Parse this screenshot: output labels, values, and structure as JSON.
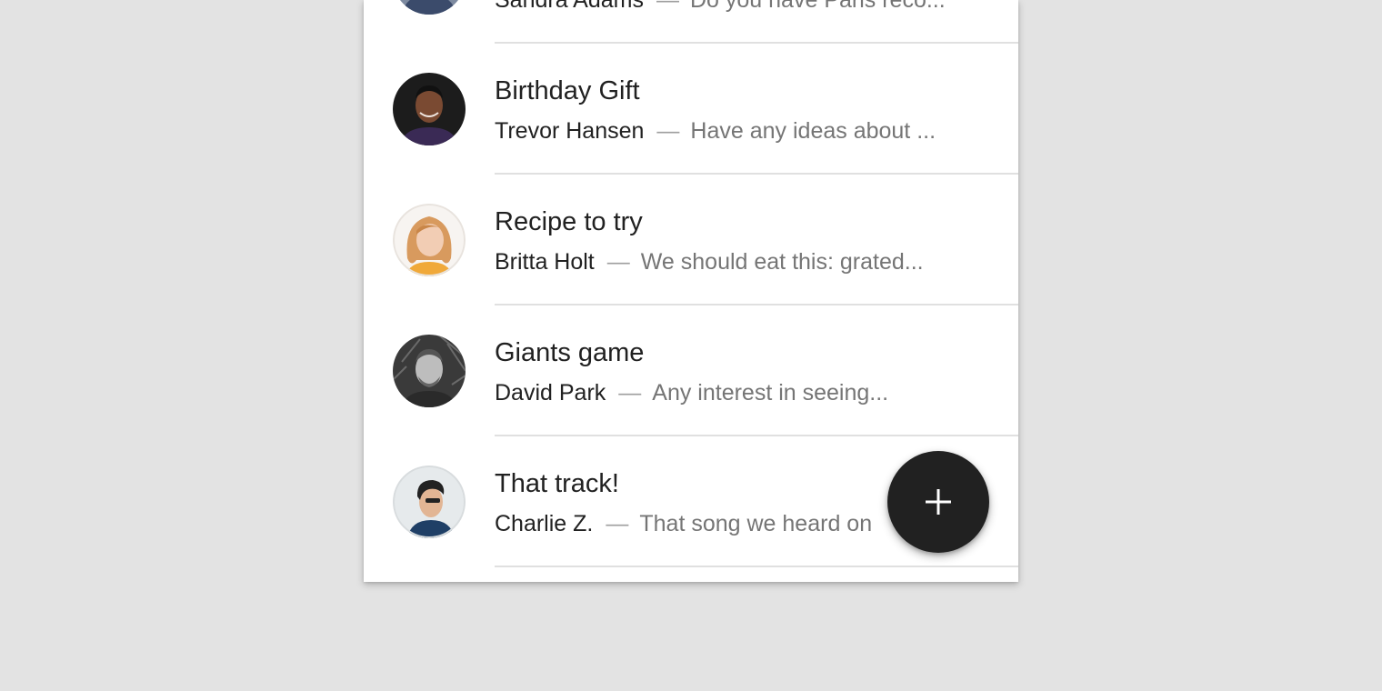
{
  "messages": [
    {
      "title": "",
      "sender": "Sandra Adams",
      "separator": "—",
      "snippet": "Do you have Paris reco...",
      "avatar": "avatar-sandra"
    },
    {
      "title": "Birthday Gift",
      "sender": "Trevor Hansen",
      "separator": "—",
      "snippet": "Have any ideas about ...",
      "avatar": "avatar-trevor"
    },
    {
      "title": "Recipe to try",
      "sender": "Britta Holt",
      "separator": "—",
      "snippet": "We should eat this: grated...",
      "avatar": "avatar-britta"
    },
    {
      "title": "Giants game",
      "sender": "David Park",
      "separator": "—",
      "snippet": "Any interest in seeing...",
      "avatar": "avatar-david"
    },
    {
      "title": "That track!",
      "sender": "Charlie Z.",
      "separator": "—",
      "snippet": "That song we heard on",
      "avatar": "avatar-charlie"
    }
  ],
  "fab": {
    "icon": "plus-icon"
  },
  "colors": {
    "background": "#e3e3e3",
    "card": "#ffffff",
    "fab": "#212121",
    "primary_text": "#212121",
    "secondary_text": "#757575",
    "divider": "#e0e0e0"
  }
}
